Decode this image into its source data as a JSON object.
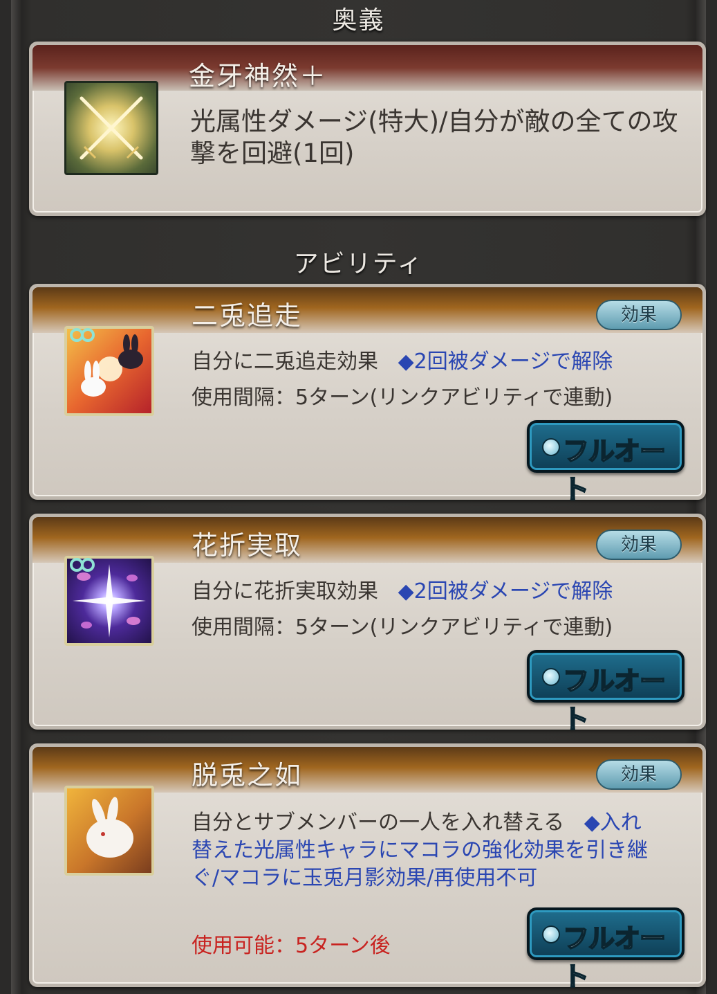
{
  "sections": {
    "ougi_title": "奥義",
    "ability_title": "アビリティ"
  },
  "ougi": {
    "name": "金牙神然＋",
    "icon": "crossed-swords-icon",
    "description": "光属性ダメージ(特大)/自分が敵の全ての攻撃を回避(1回)"
  },
  "abilities": [
    {
      "name": "二兎追走",
      "icon": "rabbits-icon",
      "linked": true,
      "effect_button": "効果",
      "effect_text": "自分に二兎追走効果",
      "note": "◆2回被ダメージで解除",
      "cooldown": "使用間隔：5ターン(リンクアビリティで連動)",
      "auto_button": "フルオート"
    },
    {
      "name": "花折実取",
      "icon": "sparkle-petals-icon",
      "linked": true,
      "effect_button": "効果",
      "effect_text": "自分に花折実取効果",
      "note": "◆2回被ダメージで解除",
      "cooldown": "使用間隔：5ターン(リンクアビリティで連動)",
      "auto_button": "フルオート"
    },
    {
      "name": "脱兎之如",
      "icon": "white-rabbit-icon",
      "linked": false,
      "effect_button": "効果",
      "effect_text": "自分とサブメンバーの一人を入れ替える",
      "note": "◆入れ替えた光属性キャラにマコラの強化効果を引き継ぐ/マコラに玉兎月影効果/再使用不可",
      "status": "使用可能：5ターン後",
      "auto_button": "フルオート"
    }
  ],
  "colors": {
    "note_blue": "#2a46b2",
    "status_red": "#c82320"
  }
}
